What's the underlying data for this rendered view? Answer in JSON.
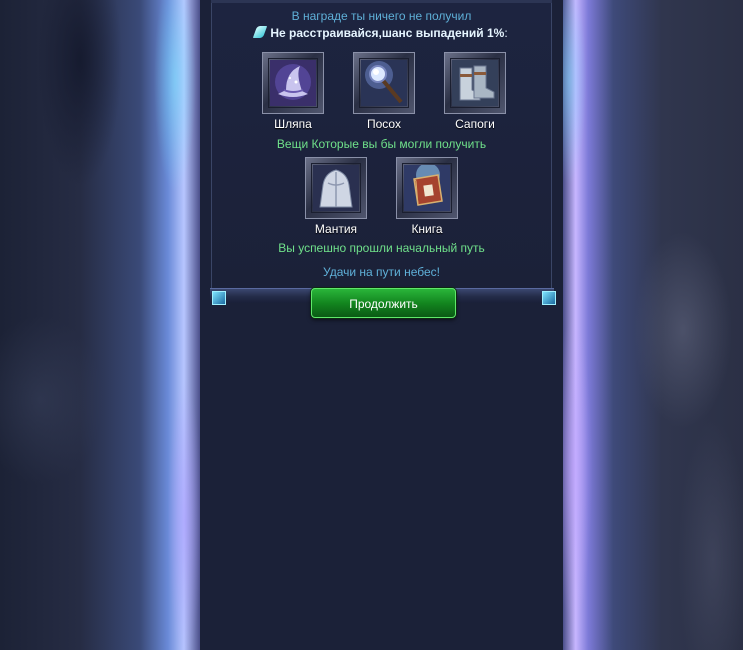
{
  "reward": {
    "nothing_text": "В наградe ты ничего не получил",
    "consolation_text": "Не расстраивайся,шанс выпадений 1%",
    "consolation_suffix": ":"
  },
  "items_row1": [
    {
      "label": "Шляпа",
      "icon": "wizard-hat-icon"
    },
    {
      "label": "Посох",
      "icon": "crystal-staff-icon"
    },
    {
      "label": "Сапоги",
      "icon": "boots-icon"
    }
  ],
  "could_get_text": "Вещи Которые вы бы могли получить",
  "items_row2": [
    {
      "label": "Мантия",
      "icon": "mantle-icon"
    },
    {
      "label": "Книга",
      "icon": "book-icon"
    }
  ],
  "path_complete_text": "Вы успешно прошли начальный путь",
  "luck_text": "Удачи на пути небес!",
  "continue_label": "Продолжить",
  "colors": {
    "info_blue": "#5fb0d8",
    "success_green": "#6fe08a",
    "button_green": "#13861f"
  }
}
